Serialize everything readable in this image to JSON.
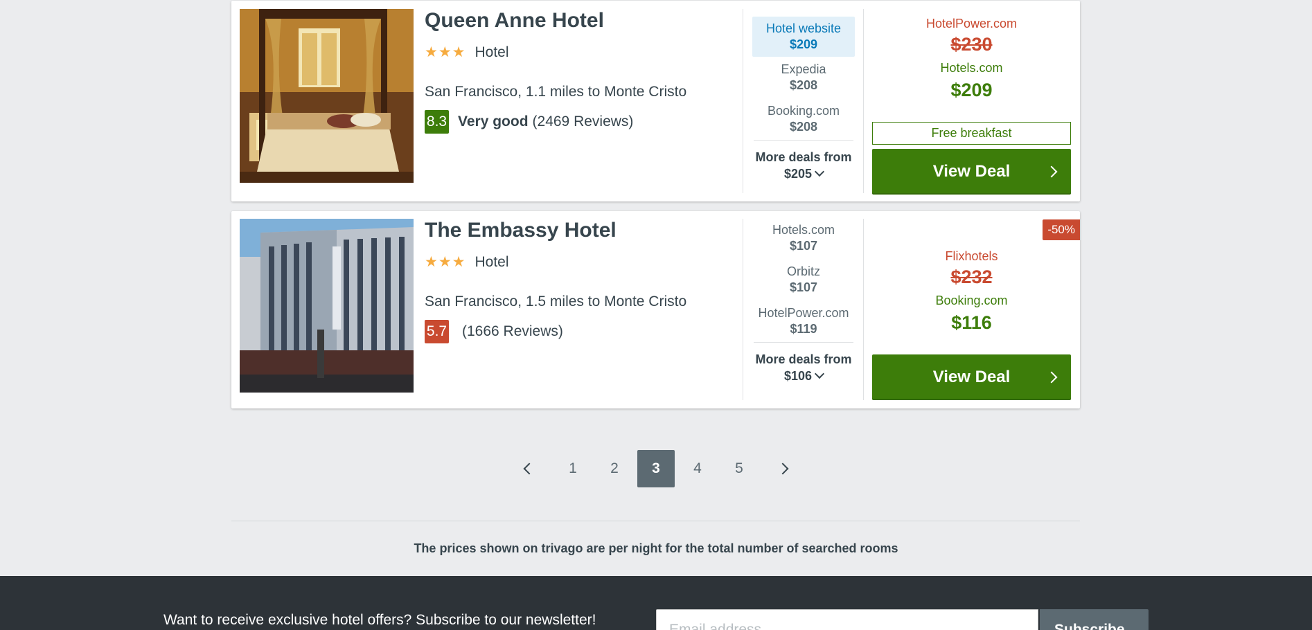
{
  "hotels": [
    {
      "name": "Queen Anne Hotel",
      "stars": "★★★",
      "type": "Hotel",
      "location": "San Francisco, 1.1 miles to Monte Cristo",
      "rating_score": "8.3",
      "rating_color": "#3d7d0a",
      "rating_text": "Very good",
      "reviews": "(2469 Reviews)",
      "deals": [
        {
          "site": "Hotel website",
          "price": "$209",
          "highlighted": true
        },
        {
          "site": "Expedia",
          "price": "$208"
        },
        {
          "site": "Booking.com",
          "price": "$208"
        }
      ],
      "more_deals_label": "More deals from",
      "more_deals_price": "$205",
      "strike_site": "HotelPower.com",
      "strike_price": "$230",
      "best_site": "Hotels.com",
      "best_price": "$209",
      "perk": "Free breakfast",
      "cta": "View Deal"
    },
    {
      "name": "The Embassy Hotel",
      "stars": "★★★",
      "type": "Hotel",
      "location": "San Francisco, 1.5 miles to Monte Cristo",
      "rating_score": "5.7",
      "rating_color": "#c94a30",
      "rating_text": "",
      "reviews": "(1666 Reviews)",
      "deals": [
        {
          "site": "Hotels.com",
          "price": "$107"
        },
        {
          "site": "Orbitz",
          "price": "$107"
        },
        {
          "site": "HotelPower.com",
          "price": "$119"
        }
      ],
      "more_deals_label": "More deals from",
      "more_deals_price": "$106",
      "discount": "-50%",
      "strike_site": "Flixhotels",
      "strike_price": "$232",
      "best_site": "Booking.com",
      "best_price": "$116",
      "cta": "View Deal"
    }
  ],
  "pagination": {
    "pages": [
      "1",
      "2",
      "3",
      "4",
      "5"
    ],
    "current": "3"
  },
  "price_note": "The prices shown on trivago are per night for the total number of searched rooms",
  "footer": {
    "newsletter_text": "Want to receive exclusive hotel offers? Subscribe to our newsletter!",
    "email_placeholder": "Email address",
    "subscribe_label": "Subscribe"
  },
  "colors": {
    "deal_green": "#3d7d0a",
    "strike_red": "#c94a30",
    "highlight_blue": "#0a7ab8",
    "footer_bg": "#2d3338"
  }
}
